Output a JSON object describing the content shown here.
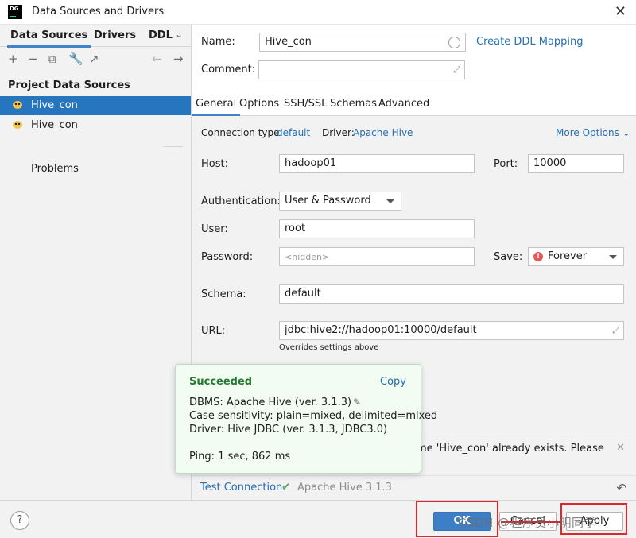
{
  "window": {
    "app_icon": "DG",
    "title": "Data Sources and Drivers",
    "close_icon": "close-icon"
  },
  "left": {
    "tabs": [
      "Data Sources",
      "Drivers",
      "DDL"
    ],
    "section_title": "Project Data Sources",
    "items": [
      {
        "label": "Hive_con",
        "selected": true
      },
      {
        "label": "Hive_con",
        "selected": false
      }
    ],
    "problems": "Problems",
    "help": "?"
  },
  "form": {
    "name_label": "Name:",
    "name_value": "Hive_con",
    "create_ddl": "Create DDL Mapping",
    "comment_label": "Comment:",
    "comment_value": "",
    "tabs": [
      "General",
      "Options",
      "SSH/SSL",
      "Schemas",
      "Advanced"
    ],
    "connection_type_label": "Connection type:",
    "connection_type_value": "default",
    "driver_label": "Driver:",
    "driver_value": "Apache Hive",
    "more_options": "More Options",
    "host_label": "Host:",
    "host_value": "hadoop01",
    "port_label": "Port:",
    "port_value": "10000",
    "auth_label": "Authentication:",
    "auth_value": "User & Password",
    "user_label": "User:",
    "user_value": "root",
    "password_label": "Password:",
    "password_placeholder": "<hidden>",
    "save_label": "Save:",
    "save_value": "Forever",
    "schema_label": "Schema:",
    "schema_value": "default",
    "url_label": "URL:",
    "url_value": "jdbc:hive2://hadoop01:10000/default",
    "url_note": "Overrides settings above"
  },
  "error": {
    "text": "me 'Hive_con' already exists. Please"
  },
  "test": {
    "link": "Test Connection",
    "version": "Apache Hive 3.1.3"
  },
  "popup": {
    "title": "Succeeded",
    "copy": "Copy",
    "dbms": "DBMS: Apache Hive (ver. 3.1.3)",
    "case": "Case sensitivity: plain=mixed, delimited=mixed",
    "driver": "Driver: Hive JDBC (ver. 3.1.3, JDBC3.0)",
    "ping": "Ping: 1 sec, 862 ms"
  },
  "buttons": {
    "ok": "OK",
    "cancel": "Cancel",
    "apply": "Apply"
  },
  "watermark": "CSDN @程序员小明同学",
  "colors": {
    "accent": "#2675bf",
    "success": "#237a2e",
    "highlight": "#e0262b"
  }
}
